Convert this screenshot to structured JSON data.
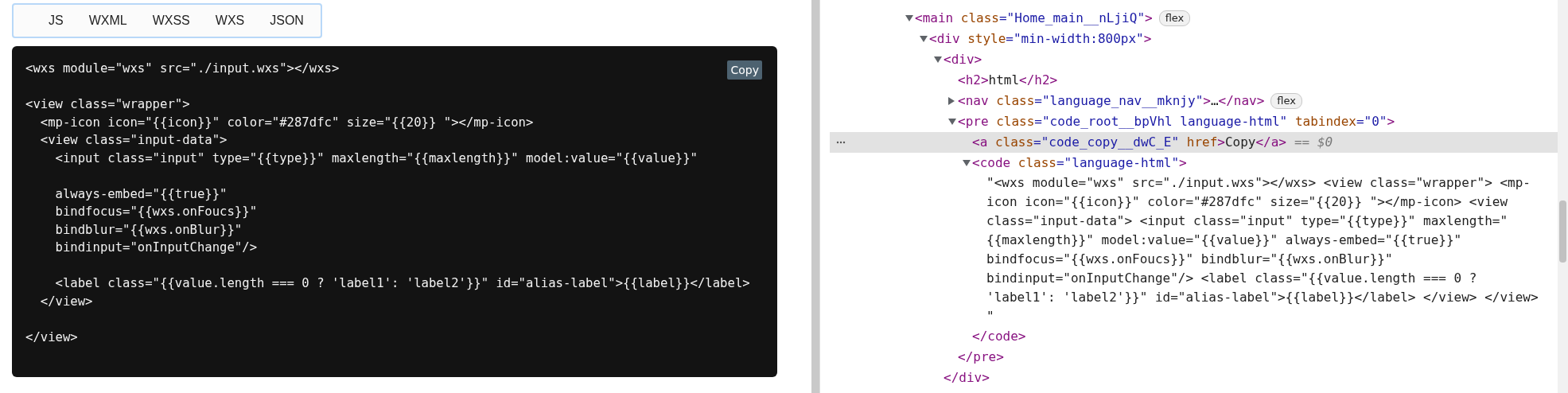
{
  "tabs": [
    {
      "label": "JS"
    },
    {
      "label": "WXML"
    },
    {
      "label": "WXSS"
    },
    {
      "label": "WXS"
    },
    {
      "label": "JSON"
    }
  ],
  "code_block": {
    "copy_button": "Copy",
    "code": "<wxs module=\"wxs\" src=\"./input.wxs\"></wxs>\n\n<view class=\"wrapper\">\n  <mp-icon icon=\"{{icon}}\" color=\"#287dfc\" size=\"{{20}} \"></mp-icon>\n  <view class=\"input-data\">\n    <input class=\"input\" type=\"{{type}}\" maxlength=\"{{maxlength}}\" model:value=\"{{value}}\"\n\n    always-embed=\"{{true}}\"\n    bindfocus=\"{{wxs.onFoucs}}\"\n    bindblur=\"{{wxs.onBlur}}\"\n    bindinput=\"onInputChange\"/>\n\n    <label class=\"{{value.length === 0 ? 'label1': 'label2'}}\" id=\"alias-label\">{{label}}</label>\n  </view>\n\n</view>"
  },
  "devtools": {
    "nodes": [
      {
        "kind": "element",
        "expanded": true,
        "selected": false,
        "badge": "flex",
        "tokens": [
          {
            "kind": "tag",
            "text": "<main"
          },
          {
            "kind": "attr",
            "text": "class"
          },
          {
            "kind": "value",
            "text": "=\"Home_main__nLjiQ\""
          },
          {
            "kind": "tag",
            "text": ">"
          }
        ],
        "children": [
          {
            "kind": "element",
            "expanded": true,
            "selected": false,
            "tokens": [
              {
                "kind": "tag",
                "text": "<div"
              },
              {
                "kind": "attr",
                "text": "style"
              },
              {
                "kind": "value",
                "text": "=\"min-width:800px\""
              },
              {
                "kind": "tag",
                "text": ">"
              }
            ],
            "children": [
              {
                "kind": "element",
                "expanded": true,
                "selected": false,
                "closing": "</div>",
                "tokens": [
                  {
                    "kind": "tag",
                    "text": "<div>"
                  }
                ],
                "children": [
                  {
                    "kind": "leaf",
                    "selected": false,
                    "tokens": [
                      {
                        "kind": "tag",
                        "text": "<h2>"
                      },
                      {
                        "kind": "text",
                        "text": "html"
                      },
                      {
                        "kind": "tag",
                        "text": "</h2>"
                      }
                    ]
                  },
                  {
                    "kind": "element",
                    "expanded": false,
                    "selected": false,
                    "badge": "flex",
                    "tokens": [
                      {
                        "kind": "tag",
                        "text": "<nav"
                      },
                      {
                        "kind": "attr",
                        "text": "class"
                      },
                      {
                        "kind": "value",
                        "text": "=\"language_nav__mknjy\""
                      },
                      {
                        "kind": "tag",
                        "text": ">"
                      },
                      {
                        "kind": "text",
                        "text": "…"
                      },
                      {
                        "kind": "tag",
                        "text": "</nav>"
                      }
                    ]
                  },
                  {
                    "kind": "element",
                    "expanded": true,
                    "selected": false,
                    "closing": "</pre>",
                    "tokens": [
                      {
                        "kind": "tag",
                        "text": "<pre"
                      },
                      {
                        "kind": "attr",
                        "text": "class"
                      },
                      {
                        "kind": "value",
                        "text": "=\"code_root__bpVhl language-html\""
                      },
                      {
                        "kind": "attr",
                        "text": "tabindex"
                      },
                      {
                        "kind": "value",
                        "text": "=\"0\""
                      },
                      {
                        "kind": "tag",
                        "text": ">"
                      }
                    ],
                    "children": [
                      {
                        "kind": "leaf",
                        "selected": true,
                        "note": "== $0",
                        "tokens": [
                          {
                            "kind": "tag",
                            "text": "<a"
                          },
                          {
                            "kind": "attr",
                            "text": "class"
                          },
                          {
                            "kind": "value",
                            "text": "=\"code_copy__dwC_E\""
                          },
                          {
                            "kind": "attr",
                            "text": "href"
                          },
                          {
                            "kind": "tag",
                            "text": ">"
                          },
                          {
                            "kind": "text",
                            "text": "Copy"
                          },
                          {
                            "kind": "tag",
                            "text": "</a>"
                          }
                        ]
                      },
                      {
                        "kind": "element",
                        "expanded": true,
                        "selected": false,
                        "closing": "</code>",
                        "tokens": [
                          {
                            "kind": "tag",
                            "text": "<code"
                          },
                          {
                            "kind": "attr",
                            "text": "class"
                          },
                          {
                            "kind": "value",
                            "text": "=\"language-html\""
                          },
                          {
                            "kind": "tag",
                            "text": ">"
                          }
                        ],
                        "children": [
                          {
                            "kind": "text",
                            "text": "\"<wxs module=\"wxs\" src=\"./input.wxs\"></wxs> <view class=\"wrapper\"> <mp-icon icon=\"{{icon}}\" color=\"#287dfc\" size=\"{{20}} \"></mp-icon> <view class=\"input-data\"> <input class=\"input\" type=\"{{type}}\" maxlength=\"{{maxlength}}\" model:value=\"{{value}}\" always-embed=\"{{true}}\" bindfocus=\"{{wxs.onFoucs}}\" bindblur=\"{{wxs.onBlur}}\" bindinput=\"onInputChange\"/> <label class=\"{{value.length === 0 ? 'label1': 'label2'}}\" id=\"alias-label\">{{label}}</label> </view> </view> \""
                          }
                        ]
                      }
                    ]
                  }
                ]
              }
            ]
          }
        ]
      }
    ]
  }
}
